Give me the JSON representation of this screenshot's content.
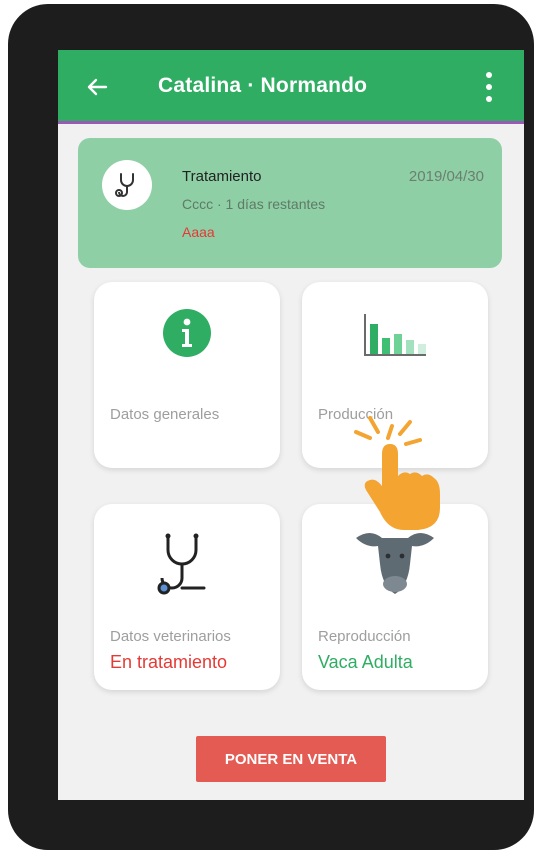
{
  "appbar": {
    "title": "Catalina · Normando",
    "color": "#2fad63",
    "back_icon": "arrow-left-icon",
    "menu_icon": "more-vertical-icon"
  },
  "treatment_card": {
    "label": "Tratamiento",
    "date": "2019/04/30",
    "subtitle": "Cccc · 1 días restantes",
    "note": "Aaaa",
    "icon": "stethoscope-icon"
  },
  "tiles": {
    "general": {
      "label": "Datos generales",
      "icon": "info-icon"
    },
    "production": {
      "label": "Producción",
      "icon": "bar-chart-icon"
    },
    "veterinary": {
      "label": "Datos veterinarios",
      "status": "En tratamiento",
      "status_color": "#e53935",
      "icon": "stethoscope-icon"
    },
    "reproduction": {
      "label": "Reproducción",
      "status": "Vaca Adulta",
      "status_color": "#2fad63",
      "icon": "cow-icon"
    }
  },
  "sell_button": {
    "label": "PONER EN VENTA",
    "color": "#e35b52"
  },
  "tap_indicator": {
    "icon": "tap-hand-icon"
  }
}
